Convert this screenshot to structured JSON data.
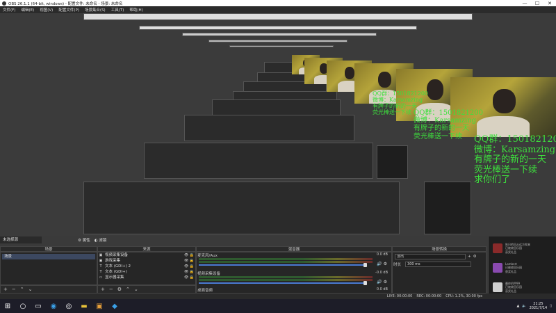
{
  "window": {
    "title": "OBS 26.1.1 (64-bit, windows) - 配置文件: 未命名 - 场景: 未命名",
    "controls": [
      "—",
      "☐",
      "✕"
    ]
  },
  "menu": [
    "文件(F)",
    "编辑(E)",
    "视图(V)",
    "配置文件(P)",
    "场景集合(S)",
    "工具(T)",
    "帮助(H)"
  ],
  "overlay": {
    "lines": [
      "QQ群：1501821200",
      "微博：Karsamzing",
      "有牌子的新的一天",
      "荧光棒送一下续",
      "求你们了"
    ]
  },
  "docks": {
    "scene_label": "未选择源",
    "props_button": "属性",
    "filters_button": "滤镜",
    "headers": {
      "scenes": "场景",
      "sources": "来源",
      "mixer": "混音器",
      "transitions": "场景转换"
    }
  },
  "scenes": {
    "items": [
      "场景"
    ]
  },
  "sources": {
    "items": [
      {
        "icon": "camera-icon",
        "glyph": "▣",
        "label": "视频采集设备"
      },
      {
        "icon": "game-capture-icon",
        "glyph": "▣",
        "label": "游戏采集"
      },
      {
        "icon": "text-icon",
        "glyph": "T",
        "label": "文本 (GDI+) 2"
      },
      {
        "icon": "text-icon",
        "glyph": "T",
        "label": "文本 (GDI+)"
      },
      {
        "icon": "display-capture-icon",
        "glyph": "▭",
        "label": "显示器采集"
      }
    ],
    "eye": "👁",
    "lock": "🔒"
  },
  "mixer": {
    "tracks": [
      {
        "name": "麦克风/Aux",
        "db": "0.0 dB"
      },
      {
        "name": "视频采集设备",
        "db": "-0.0 dB"
      },
      {
        "name": "桌面音频",
        "db": "0.0 dB"
      }
    ]
  },
  "transitions": {
    "type": "淡出",
    "duration_label": "时长",
    "duration_value": "300 ms"
  },
  "notifications": [
    {
      "name": "秋日的风从远方吹来",
      "line2": "已被收回乐园",
      "line3": "获奖礼品",
      "color": "#8a2a2a"
    },
    {
      "name": "Lambert",
      "line2": "已被收回乐园",
      "line3": "获奖礼品",
      "color": "#8a4ab0"
    },
    {
      "name": "最终机甲99",
      "line2": "已被收回乐园",
      "line3": "获奖礼品",
      "color": "#d0d0d0"
    }
  ],
  "status": {
    "live": "LIVE: 00:00:00",
    "rec": "REC: 00:00:00",
    "cpu": "CPU: 1.2%, 30.00 fps"
  },
  "taskbar": {
    "time": "21:25",
    "date": "2021/7/14"
  }
}
